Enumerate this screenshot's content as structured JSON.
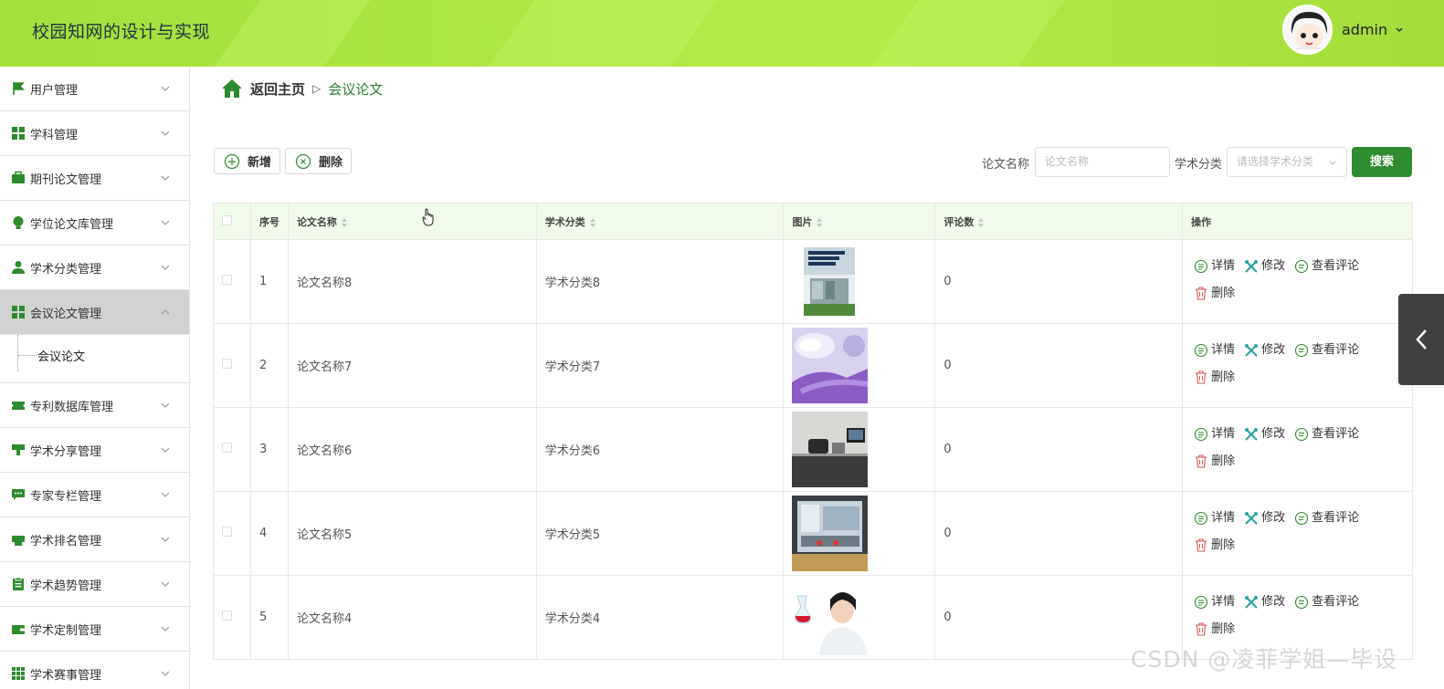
{
  "header": {
    "title": "校园知网的设计与实现",
    "user": "admin"
  },
  "sidebar": {
    "items": [
      {
        "label": "用户管理",
        "icon": "flag-icon"
      },
      {
        "label": "学科管理",
        "icon": "grid-icon"
      },
      {
        "label": "期刊论文管理",
        "icon": "briefcase-icon"
      },
      {
        "label": "学位论文库管理",
        "icon": "bulb-icon"
      },
      {
        "label": "学术分类管理",
        "icon": "user-icon"
      },
      {
        "label": "会议论文管理",
        "icon": "grid-icon",
        "active": true
      },
      {
        "label": "专利数据库管理",
        "icon": "ticket-icon"
      },
      {
        "label": "学术分享管理",
        "icon": "stamp-icon"
      },
      {
        "label": "专家专栏管理",
        "icon": "chat-icon"
      },
      {
        "label": "学术排名管理",
        "icon": "printer-icon"
      },
      {
        "label": "学术趋势管理",
        "icon": "clipboard-icon"
      },
      {
        "label": "学术定制管理",
        "icon": "wallet-icon"
      },
      {
        "label": "学术赛事管理",
        "icon": "apps-icon"
      }
    ],
    "submenu_label": "会议论文"
  },
  "breadcrumb": {
    "home": "返回主页",
    "current": "会议论文"
  },
  "toolbar": {
    "add": "新增",
    "delete": "删除"
  },
  "search": {
    "name_label": "论文名称",
    "name_placeholder": "论文名称",
    "category_label": "学术分类",
    "category_placeholder": "请选择学术分类",
    "button": "搜索"
  },
  "table": {
    "headers": {
      "index": "序号",
      "name": "论文名称",
      "category": "学术分类",
      "image": "图片",
      "comments": "评论数",
      "actions": "操作"
    },
    "actions": {
      "detail": "详情",
      "edit": "修改",
      "view_comments": "查看评论",
      "delete": "删除"
    },
    "rows": [
      {
        "index": "1",
        "name": "论文名称8",
        "category": "学术分类8",
        "comments": "0",
        "image": "book-cover"
      },
      {
        "index": "2",
        "name": "论文名称7",
        "category": "学术分类7",
        "comments": "0",
        "image": "lab-gloves"
      },
      {
        "index": "3",
        "name": "论文名称6",
        "category": "学术分类6",
        "comments": "0",
        "image": "lab-equipment"
      },
      {
        "index": "4",
        "name": "论文名称5",
        "category": "学术分类5",
        "comments": "0",
        "image": "lab-room"
      },
      {
        "index": "5",
        "name": "论文名称4",
        "category": "学术分类4",
        "comments": "0",
        "image": "scientist-flask"
      }
    ]
  },
  "watermark": "CSDN @凌菲学姐—毕设",
  "colors": {
    "header": "#a9e442",
    "accent": "#2e8b2e",
    "table_header": "#f1fbe9"
  }
}
